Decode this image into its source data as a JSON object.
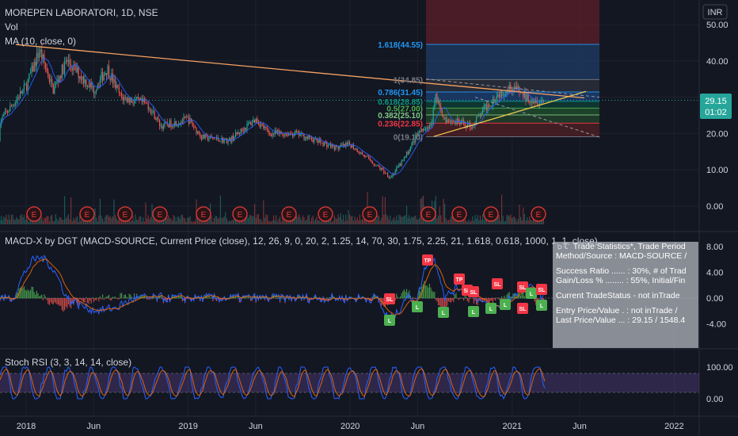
{
  "header": {
    "symbol_title": "MOREPEN LABORATORI, 1D, NSE",
    "vol_label": "Vol",
    "ma_label": "MA (10, close, 0)",
    "currency": "INR"
  },
  "price_axis": {
    "ticks": [
      "50.00",
      "40.00",
      "30.00",
      "20.00",
      "10.00",
      "0.00"
    ],
    "last_price": "29.15",
    "countdown": "01:02"
  },
  "time_axis": {
    "ticks": [
      "2018",
      "Jun",
      "2019",
      "Jun",
      "2020",
      "Jun",
      "2021",
      "Jun",
      "2022"
    ]
  },
  "fib_levels": [
    {
      "label": "1.618(44.55)",
      "color": "#2196f3"
    },
    {
      "label": "1(34.85)",
      "color": "#787b86"
    },
    {
      "label": "0.786(31.45)",
      "color": "#2196f3"
    },
    {
      "label": "0.618(28.85)",
      "color": "#089981"
    },
    {
      "label": "0.5(27.00)",
      "color": "#4caf50"
    },
    {
      "label": "0.382(25.10)",
      "color": "#81c784"
    },
    {
      "label": "0.236(22.85)",
      "color": "#f23645"
    },
    {
      "label": "0(19.10)",
      "color": "#787b86"
    }
  ],
  "earnings_marker": "E",
  "macd": {
    "title": "MACD-X by DGT (MACD-SOURCE, Current Price (close), 12, 26, 9, 0, 20, 2, 1.25, 14, 70, 30, 1.75, 2.25, 21, 1.618, 0.618, 1000, 1, 1, close)",
    "ticks": [
      "8.00",
      "4.00",
      "0.00",
      "-4.00"
    ],
    "signals": [
      "SL",
      "L",
      "L",
      "TP",
      "L",
      "TP",
      "SL",
      "L",
      "SL",
      "L",
      "SL",
      "L",
      "SL",
      "SL",
      "L",
      "SL",
      "L"
    ]
  },
  "stats_panel": {
    "line1": "☼☾ Trade Statistics*, Trade Period",
    "line2": "Method/Source : MACD-SOURCE /",
    "line3": "Success Ratio ...... : 30%, # of Trad",
    "line4": "Gain/Loss % ........ : 55%, Initial/Fin",
    "line5": "Current TradeStatus - not inTrade",
    "line6": "Entry Price/Value . : not inTrade /",
    "line7": "Last Price/Value ... : 29.15 / 1548.4"
  },
  "stoch": {
    "title": "Stoch RSI (3, 3, 14, 14, close)",
    "ticks": [
      "100.00",
      "0.00"
    ]
  },
  "colors": {
    "background": "#131722",
    "up": "#26a69a",
    "down": "#ef5350",
    "trendline": "#f5a262",
    "macd_line": "#2962ff",
    "signal_line": "#ff6d00",
    "stoch_k": "#2962ff",
    "stoch_d": "#ff6d00",
    "stoch_band": "#7e57c2",
    "last_price_tag": "#26a69a",
    "earnings": "#e53935"
  },
  "chart_data": [
    {
      "type": "candlestick",
      "title": "MOREPEN LABORATORI, 1D, NSE",
      "x_range": [
        "2017-11",
        "2022-03"
      ],
      "ylim": [
        -5,
        55
      ],
      "series": [
        {
          "name": "MA (10, close, 0)",
          "x": [
            "2017-11",
            "2018-01",
            "2018-02",
            "2018-04",
            "2018-06",
            "2018-09",
            "2018-12",
            "2019-03",
            "2019-06",
            "2019-09",
            "2019-12",
            "2020-02",
            "2020-04",
            "2020-05",
            "2020-06",
            "2020-08",
            "2020-10",
            "2020-12",
            "2021-01",
            "2021-03",
            "2021-04"
          ],
          "values": [
            18,
            38,
            42,
            35,
            30,
            26,
            22,
            18,
            19,
            18,
            16,
            15,
            9,
            18,
            28,
            23,
            26,
            29,
            34,
            29,
            28
          ]
        }
      ],
      "last_price": 29.15
    },
    {
      "type": "line",
      "title": "MACD-X by DGT",
      "ylim": [
        -7,
        9
      ],
      "series": [
        {
          "name": "MACD",
          "x": [
            "2017-11",
            "2018-01",
            "2018-03",
            "2018-06",
            "2018-09",
            "2018-12",
            "2019-06",
            "2019-12",
            "2020-04",
            "2020-06",
            "2020-08",
            "2020-11",
            "2021-01",
            "2021-04"
          ],
          "values": [
            0.5,
            3.5,
            7.0,
            0.5,
            -1.5,
            0.0,
            0.0,
            0.0,
            -2.5,
            4.5,
            0.5,
            1.5,
            1.2,
            0.3
          ]
        }
      ]
    },
    {
      "type": "line",
      "title": "Stoch RSI (3, 3, 14, 14, close)",
      "ylim": [
        -20,
        120
      ],
      "band": [
        20,
        80
      ],
      "series": [
        {
          "name": "K",
          "x": [
            "2018",
            "2019",
            "2020",
            "2021"
          ],
          "values": [
            50,
            50,
            50,
            50
          ]
        }
      ]
    }
  ]
}
